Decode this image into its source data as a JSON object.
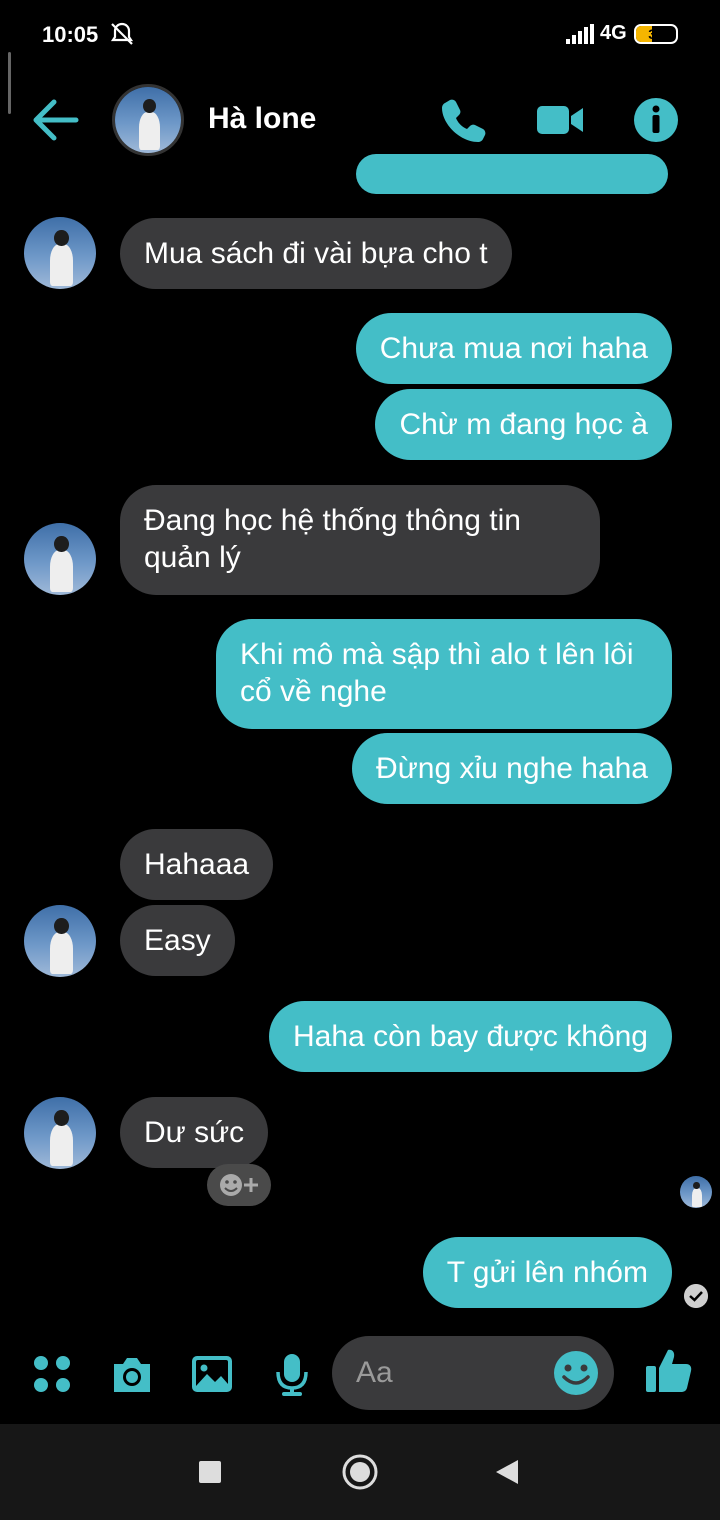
{
  "status_bar": {
    "time": "10:05",
    "network": "4G",
    "battery": "39"
  },
  "header": {
    "contact_name": "Hà lone"
  },
  "messages": [
    {
      "dir": "in",
      "text": "Mua sách đi vài bựa cho t"
    },
    {
      "dir": "out",
      "text": "Chưa mua nơi haha"
    },
    {
      "dir": "out",
      "text": "Chừ m đang học à"
    },
    {
      "dir": "in",
      "text": "Đang học hệ thống thông tin quản lý"
    },
    {
      "dir": "out",
      "text": "Khi mô mà sập thì alo t lên lôi cổ về nghe"
    },
    {
      "dir": "out",
      "text": "Đừng xỉu nghe haha"
    },
    {
      "dir": "in",
      "text": "Hahaaa"
    },
    {
      "dir": "in",
      "text": "Easy"
    },
    {
      "dir": "out",
      "text": "Haha còn bay được không"
    },
    {
      "dir": "in",
      "text": "Dư sức"
    },
    {
      "dir": "out",
      "text": "T gửi lên nhóm"
    }
  ],
  "composer": {
    "placeholder": "Aa"
  },
  "colors": {
    "accent": "#44bec7",
    "incoming_bubble": "#3a3a3c",
    "background": "#000000"
  },
  "icons": [
    "back-arrow-icon",
    "phone-icon",
    "video-icon",
    "info-icon",
    "menu-dots-icon",
    "camera-icon",
    "image-icon",
    "mic-icon",
    "emoji-icon",
    "like-icon",
    "add-reaction-icon",
    "square-nav-icon",
    "home-nav-icon",
    "back-nav-icon"
  ]
}
